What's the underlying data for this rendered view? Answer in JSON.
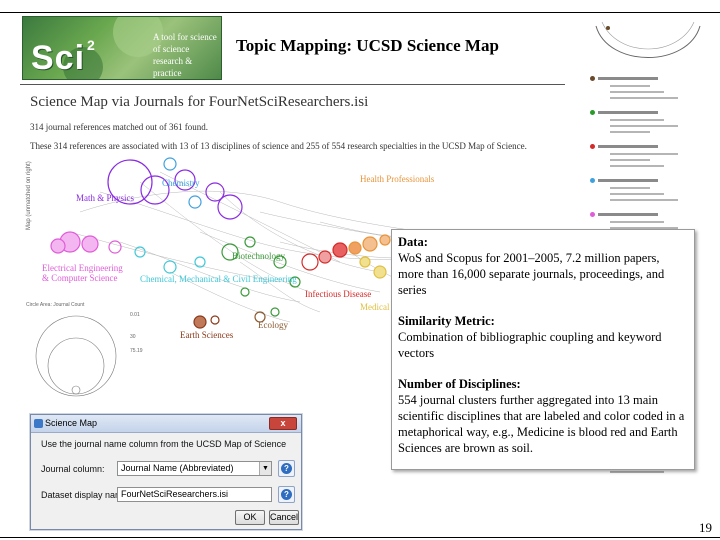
{
  "slide": {
    "title": "Topic Mapping: UCSD Science Map",
    "page_number": "19"
  },
  "logo": {
    "text": "Sci",
    "superscript": "2",
    "tagline": "A tool for science of science research & practice"
  },
  "science_map": {
    "heading": "Science Map via Journals for FourNetSciResearchers.isi",
    "matched_line": "314 journal references matched out of 361 found.",
    "disciplines_line": "These 314 references are associated with 13 of 13 disciplines of science and 255 of 554 research specialties in the UCSD Map of Science.",
    "axis_note": "Map (unmatched on right)",
    "inset_title": "Circle Area: Journal Count",
    "inset_values": [
      "0.01",
      "30",
      "75.19"
    ],
    "discipline_labels": {
      "math_physics": "Math & Physics",
      "chemistry": "Chemistry",
      "health_professionals": "Health Professionals",
      "electrical_engineering": "Electrical Engineering & Computer Science",
      "biotechnology": "Biotechnology",
      "chemical_engineering": "Chemical, Mechanical & Civil Engineering",
      "infectious_disease": "Infectious Disease",
      "medical_specialties": "Medical Specialties",
      "ecology": "Ecology",
      "earth_sciences": "Earth Sciences"
    },
    "colors": {
      "math_physics": "#8a2be2",
      "chemistry": "#3fa0e0",
      "health_professionals": "#e8943a",
      "electrical_engineering": "#e05cd8",
      "biotechnology": "#3a9a3a",
      "chemical_engineering": "#40c8d8",
      "infectious_disease": "#d42a2a",
      "medical_specialties": "#e0c040",
      "ecology": "#8a5a30",
      "earth_sciences": "#8a3a1a"
    }
  },
  "dialog": {
    "title": "Science Map",
    "close_label": "x",
    "description": "Use the journal name column from the UCSD Map of Science",
    "journal_column_label": "Journal column:",
    "journal_column_value": "Journal Name (Abbreviated)",
    "dataset_label": "Dataset display name:",
    "dataset_value": "FourNetSciResearchers.isi",
    "help_label": "?",
    "ok_label": "OK",
    "cancel_label": "Cancel"
  },
  "info": {
    "data_heading": "Data:",
    "data_text": "WoS and Scopus for 2001–2005, 7.2 million papers, more than 16,000 separate journals, proceedings, and series",
    "similarity_heading": "Similarity Metric:",
    "similarity_text": "Combination of bibliographic coupling and keyword vectors",
    "disciplines_heading": "Number of Disciplines:",
    "disciplines_text": "554 journal clusters further aggregated into 13 main scientific disciplines that are labeled and color coded in a metaphorical way, e.g., Medicine is blood red and Earth Sciences are brown as soil."
  },
  "legend_colors": [
    "#6a4a2a",
    "#2a9a2a",
    "#d42a2a",
    "#3fa0e0",
    "#e05cd8",
    "#8a2be2",
    "#d42a2a",
    "#a0522d",
    "#e8943a",
    "#40c8d8",
    "#8a3a1a",
    "#9a3ac8"
  ]
}
